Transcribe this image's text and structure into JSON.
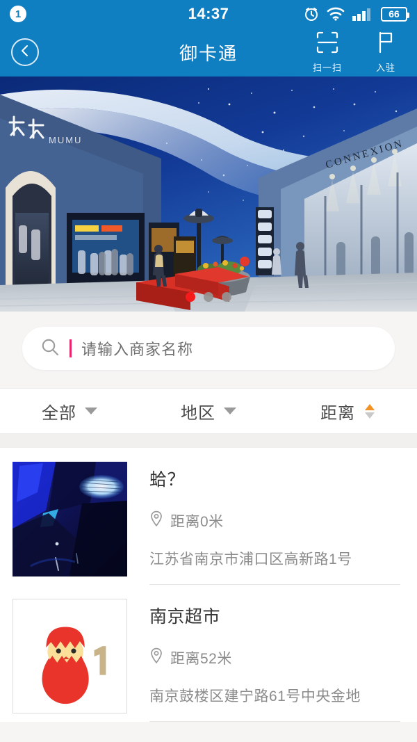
{
  "status_bar": {
    "notification_count": "1",
    "time": "14:37",
    "battery_level": "66",
    "icons": [
      "alarm-clock-icon",
      "wifi-icon",
      "cellular-signal-icon",
      "battery-icon"
    ]
  },
  "nav_bar": {
    "back_icon": "chevron-left-icon",
    "title": "御卡通",
    "actions": [
      {
        "icon": "scan-frame-icon",
        "label": "扫一扫"
      },
      {
        "icon": "flag-icon",
        "label": "入驻"
      }
    ]
  },
  "banner": {
    "alt": "shopping-mall-corridor-night-sky-ceiling",
    "store_signs": [
      "木木 MUMU",
      "CONNEXION"
    ],
    "dots": [
      {
        "active": true
      },
      {
        "active": false
      },
      {
        "active": false
      }
    ]
  },
  "search": {
    "icon": "search-icon",
    "value": "",
    "placeholder": "请输入商家名称",
    "caret_color": "#e8256b"
  },
  "filters": [
    {
      "label": "全部",
      "control": "chevron-down-icon",
      "sort": null
    },
    {
      "label": "地区",
      "control": "chevron-down-icon",
      "sort": null
    },
    {
      "label": "距离",
      "control": "sort-arrows-icon",
      "sort": "asc"
    }
  ],
  "merchants": [
    {
      "name": "蛤？",
      "distance": "距离0米",
      "address": "江苏省南京市浦口区高新路1号",
      "pin_icon": "location-pin-icon",
      "thumb": "dark-blue-room-photo",
      "framed": false
    },
    {
      "name": "南京超市",
      "distance": "距离52米",
      "address": "南京鼓楼区建宁路61号中央金地",
      "pin_icon": "location-pin-icon",
      "thumb": "red-egg-chick-logo-1",
      "framed": true
    }
  ],
  "colors": {
    "brand_blue": "#107fc2",
    "page_bg": "#f7f5f4",
    "accent_orange": "#f29124",
    "dot_active": "#f71a1a",
    "caret_pink": "#e8256b"
  }
}
